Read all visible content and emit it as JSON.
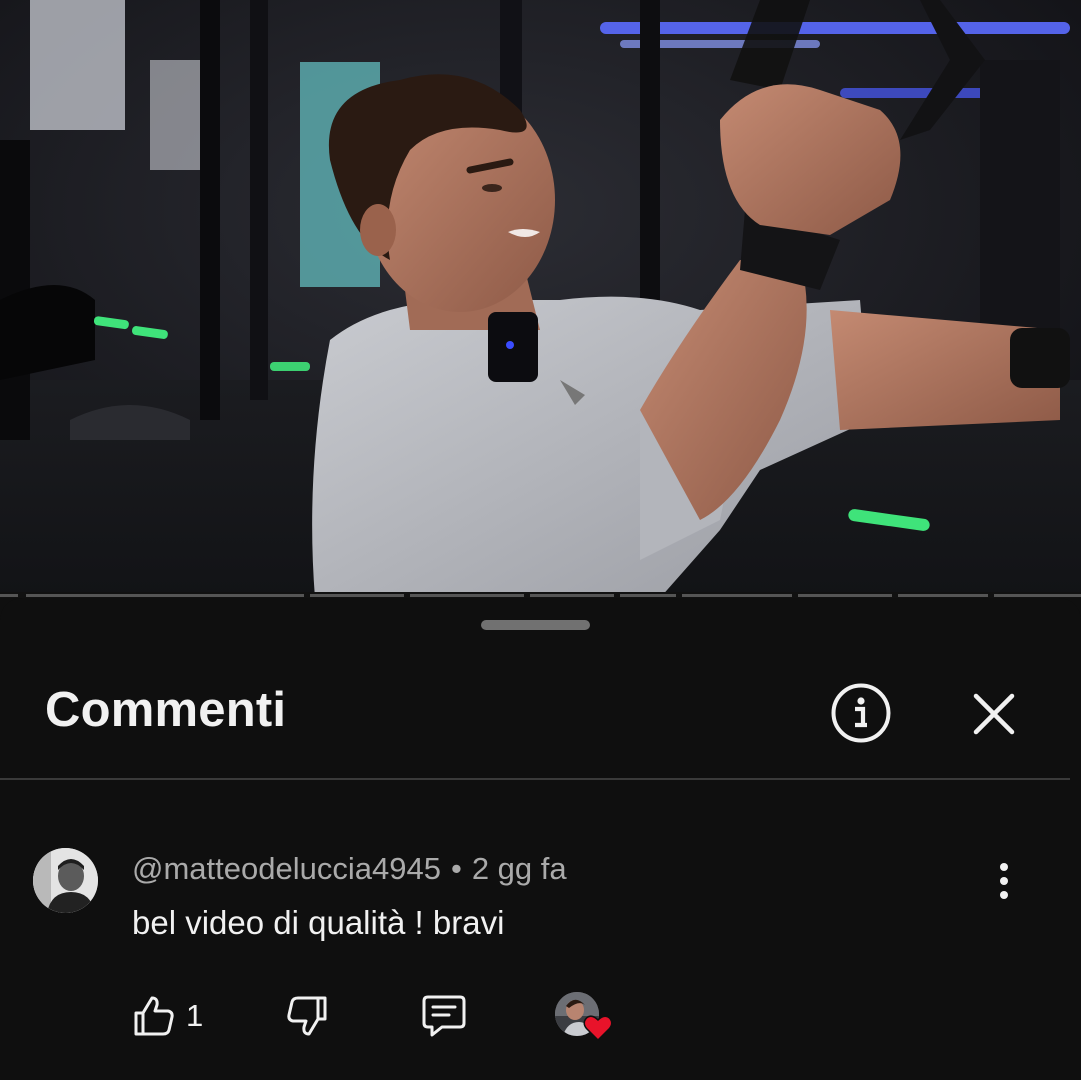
{
  "video": {
    "scene": "gym-workout-frame",
    "progress_segments": 10
  },
  "comments_sheet": {
    "title": "Commenti",
    "info_icon": "info-circle-icon",
    "close_icon": "close-icon"
  },
  "comment": {
    "author": "@matteodeluccia4945",
    "separator": "•",
    "timestamp": "2 gg fa",
    "text": "bel video di qualità ! bravi",
    "like_count": "1",
    "icons": {
      "like": "thumbs-up-icon",
      "dislike": "thumbs-down-icon",
      "reply": "reply-icon",
      "more": "more-vertical-icon",
      "creator_heart": "creator-heart-icon"
    }
  },
  "colors": {
    "background": "#0f0f0f",
    "text_primary": "#f1f1f1",
    "text_secondary": "#aaaaaa",
    "heart": "#e8132a",
    "gym_neon_green": "#3fe37a",
    "gym_neon_blue": "#5b6cff"
  }
}
